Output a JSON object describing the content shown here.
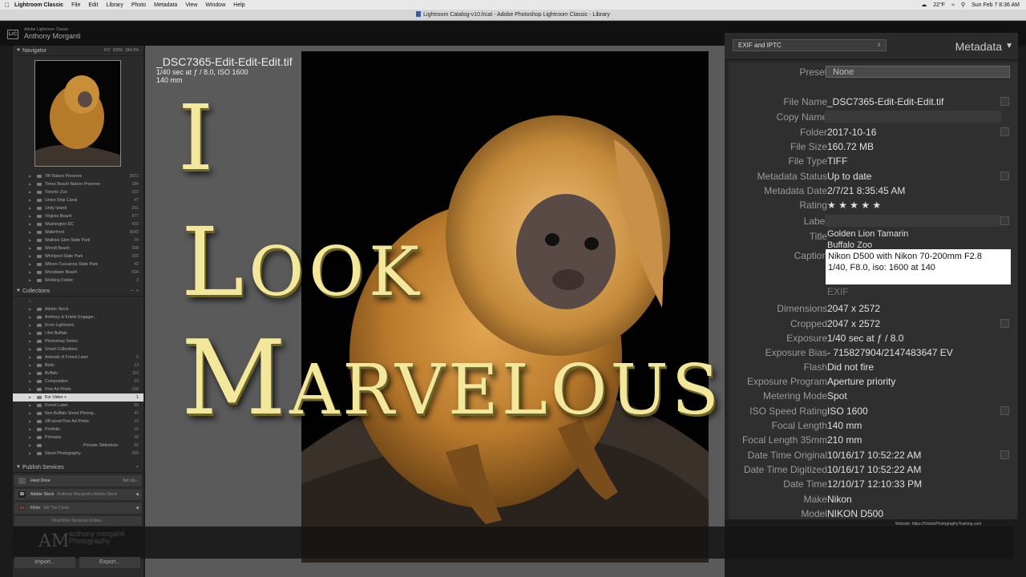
{
  "menubar": {
    "app": "Lightroom Classic",
    "items": [
      "File",
      "Edit",
      "Library",
      "Photo",
      "Metadata",
      "View",
      "Window",
      "Help"
    ],
    "temp": "22°F",
    "datetime": "Sun Feb 7  8:36 AM"
  },
  "window": {
    "title": "Lightroom Catalog-v10.lrcat - Adobe Photoshop Lightroom Classic - Library"
  },
  "identity": {
    "line1": "Adobe Lightroom Classic",
    "line2": "Anthony Morganti"
  },
  "navigator": {
    "title": "Navigator",
    "zoom_options": [
      "FIT",
      "100%",
      "184.3%"
    ]
  },
  "folders": [
    {
      "name": "Tift Nature Preserve",
      "count": "2672"
    },
    {
      "name": "Times Beach Nature Preserve",
      "count": "184"
    },
    {
      "name": "Toronto Zoo",
      "count": "102"
    },
    {
      "name": "Union Ship Canal",
      "count": "47"
    },
    {
      "name": "Unity Island",
      "count": "251"
    },
    {
      "name": "Virginia Beach",
      "count": "877"
    },
    {
      "name": "Washington DC",
      "count": "433"
    },
    {
      "name": "Waterfront",
      "count": "3643"
    },
    {
      "name": "Watkins Glen State Park",
      "count": "79"
    },
    {
      "name": "Wendt Beach",
      "count": "338"
    },
    {
      "name": "Whirlpool State Park",
      "count": "165"
    },
    {
      "name": "Wilson-Tuscarora State Park",
      "count": "42"
    },
    {
      "name": "Woodlawn Beach",
      "count": "606"
    },
    {
      "name": "Working Folder",
      "count": "3"
    }
  ],
  "collections": {
    "title": "Collections",
    "items": [
      {
        "name": "Adobe Stock",
        "count": ""
      },
      {
        "name": "Anthony & Kristie Engager...",
        "count": ""
      },
      {
        "name": "From Lightroom",
        "count": ""
      },
      {
        "name": "I Am Buffalo",
        "count": ""
      },
      {
        "name": "Photoshop Series",
        "count": ""
      },
      {
        "name": "Smart Collections",
        "count": ""
      },
      {
        "name": "Animals of Forest Lawn",
        "count": "5"
      },
      {
        "name": "Birds",
        "count": "13"
      },
      {
        "name": "Buffalo",
        "count": "110"
      },
      {
        "name": "Composition",
        "count": "23"
      },
      {
        "name": "Fine Art Prints",
        "count": "166"
      },
      {
        "name": "For Video +",
        "count": "1"
      },
      {
        "name": "Forest Lawn",
        "count": "95"
      },
      {
        "name": "Non-Buffalo Street Photog...",
        "count": "47"
      },
      {
        "name": "Off-sized Fine Art Prints",
        "count": "10"
      },
      {
        "name": "Portfolio",
        "count": "15"
      },
      {
        "name": "Primates",
        "count": "26"
      },
      {
        "name": "Primate Slideshow",
        "count": "26"
      },
      {
        "name": "Street Photography",
        "count": "209"
      }
    ]
  },
  "publish": {
    "title": "Publish Services",
    "hard_drive": "Hard Drive",
    "hard_drive_action": "Set Up...",
    "adobe_stock": "Adobe Stock",
    "adobe_stock_sub": "Anthony Morganti's Adobe Stock",
    "flickr": "Flickr",
    "flickr_sub": "Kill The Clock",
    "find_more": "Find More Services Online..."
  },
  "buttons": {
    "import": "Import...",
    "export": "Export..."
  },
  "watermark": {
    "mark": "AM",
    "name": "anthony morganti",
    "sub": "Photography"
  },
  "website": "Website:   https://OnlinePhotographyTraining.com",
  "loupe_info": {
    "filename": "_DSC7365-Edit-Edit-Edit.tif",
    "line2": "1/40 sec at ƒ / 8.0, ISO 1600",
    "line3": "140 mm"
  },
  "overlay": {
    "word1": "I",
    "word2_first": "L",
    "word2_rest": "OOK",
    "word3_first": "M",
    "word3_rest": "ARVELOUS"
  },
  "metadata": {
    "set": "EXIF and IPTC",
    "panel_title": "Metadata",
    "preset_label": "Preset",
    "preset_value": "None",
    "fields": [
      {
        "label": "File Name",
        "value": "_DSC7365-Edit-Edit-Edit.tif"
      },
      {
        "label": "Copy Name",
        "value": ""
      },
      {
        "label": "Folder",
        "value": "2017-10-16"
      },
      {
        "label": "File Size",
        "value": "160.72 MB"
      },
      {
        "label": "File Type",
        "value": "TIFF"
      },
      {
        "label": "Metadata Status",
        "value": "Up to date"
      },
      {
        "label": "Metadata Date",
        "value": "2/7/21 8:35:45 AM"
      },
      {
        "label": "Rating",
        "value": "★ ★ ★ ★ ★"
      },
      {
        "label": "Label",
        "value": ""
      }
    ],
    "title_label": "Title",
    "title_value": "Golden Lion Tamarin\nBuffalo Zoo",
    "caption_label": "Caption",
    "caption_value": "Nikon D500 with Nikon 70-200mm F2.8\n1/40, F8.0, iso: 1600 at 140",
    "exif_label": "EXIF",
    "exif": [
      {
        "label": "Dimensions",
        "value": "2047 x 2572"
      },
      {
        "label": "Cropped",
        "value": "2047 x 2572"
      },
      {
        "label": "Exposure",
        "value": "1/40 sec at ƒ / 8.0"
      },
      {
        "label": "Exposure Bias",
        "value": "- 715827904/2147483647 EV"
      },
      {
        "label": "Flash",
        "value": "Did not fire"
      },
      {
        "label": "Exposure Program",
        "value": "Aperture priority"
      },
      {
        "label": "Metering Mode",
        "value": "Spot"
      },
      {
        "label": "ISO Speed Rating",
        "value": "ISO 1600"
      },
      {
        "label": "Focal Length",
        "value": "140 mm"
      },
      {
        "label": "Focal Length 35mm",
        "value": "210 mm"
      },
      {
        "label": "Date Time Original",
        "value": "10/16/17 10:52:22 AM"
      },
      {
        "label": "Date Time Digitized",
        "value": "10/16/17 10:52:22 AM"
      },
      {
        "label": "Date Time",
        "value": "12/10/17 12:10:33 PM"
      },
      {
        "label": "Make",
        "value": "Nikon"
      },
      {
        "label": "Model",
        "value": "NIKON D500"
      }
    ]
  }
}
